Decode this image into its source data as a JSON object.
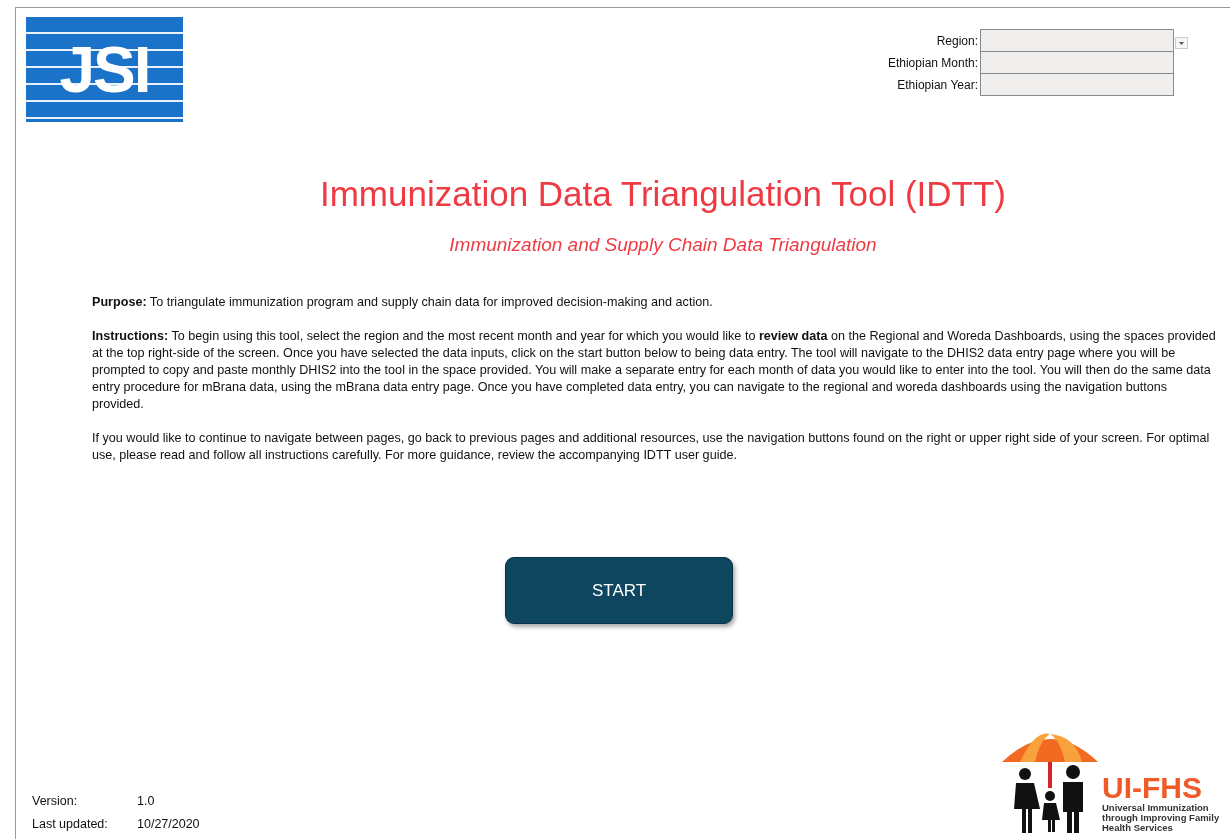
{
  "logo": {
    "text": "JSI"
  },
  "filters": [
    {
      "label": "Region:",
      "kind": "dropdown"
    },
    {
      "label": "Ethiopian Month:",
      "kind": "text"
    },
    {
      "label": "Ethiopian Year:",
      "kind": "text"
    }
  ],
  "title": "Immunization Data Triangulation Tool (IDTT)",
  "subtitle": "Immunization and Supply Chain Data Triangulation",
  "paragraphs": [
    "**Purpose:** To triangulate immunization program and supply chain data for improved decision-making and action.",
    "**Instructions:** To begin using this tool, select the region and  the most recent month and year for which you would like to **review data** on the Regional and Woreda Dashboards, using the spaces provided at the top right-side of the screen. Once you have selected the data inputs, click on the start button below to being data entry. The tool will navigate to the DHIS2 data entry page where you will be prompted to copy and paste monthly DHIS2 into the tool in the space provided. You will make a separate entry for each month of data you would like to enter into the tool. You will then do the same data entry procedure for mBrana data, using the mBrana data entry page. Once you have completed data entry, you can navigate to the regional and woreda dashboards using the navigation buttons provided.",
    "If you would like to continue to navigate between pages, go back to previous pages and additional resources, use the navigation buttons found on the right or upper right side of your screen. For optimal use, please read and follow all instructions carefully. For more guidance, review  the accompanying IDTT user guide."
  ],
  "start_button": "START",
  "footer": {
    "version_label": "Version:",
    "version": "1.0",
    "updated_label": "Last updated:",
    "updated": "10/27/2020"
  },
  "partner_logo": {
    "name": "UI-FHS",
    "tagline": "Universal Immunization through Improving Family Health Services"
  }
}
